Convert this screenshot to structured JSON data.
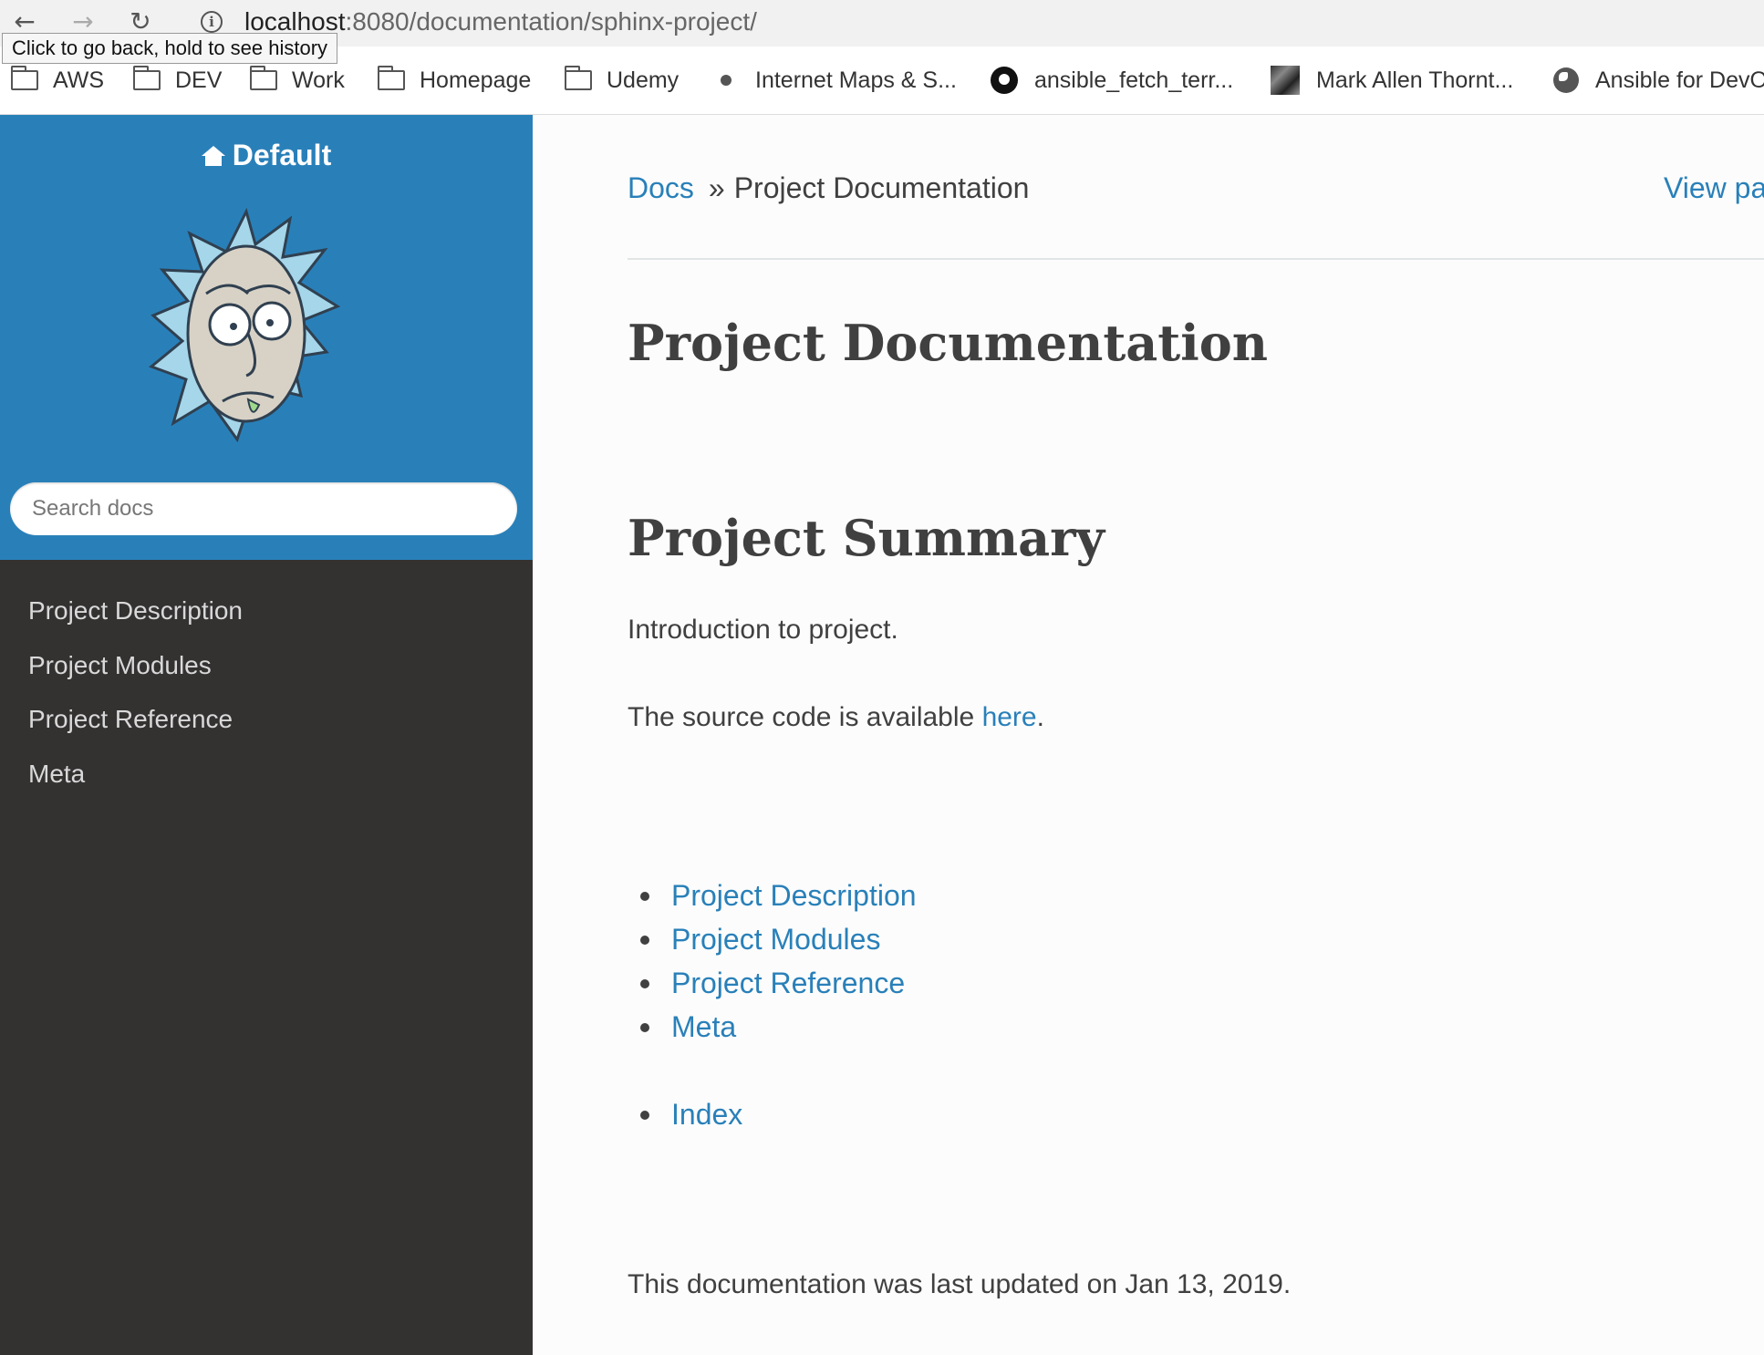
{
  "browser": {
    "url_host": "localhost",
    "url_path": ":8080/documentation/sphinx-project/",
    "tooltip": "Click to go back, hold to see history"
  },
  "bookmarks": [
    {
      "label": "AWS",
      "icon": "folder-icon"
    },
    {
      "label": "DEV",
      "icon": "folder-icon"
    },
    {
      "label": "Work",
      "icon": "folder-icon"
    },
    {
      "label": "Homepage",
      "icon": "folder-icon"
    },
    {
      "label": "Udemy",
      "icon": "folder-icon"
    },
    {
      "label": "Internet Maps & S...",
      "icon": "dot-icon"
    },
    {
      "label": "ansible_fetch_terr...",
      "icon": "github-icon"
    },
    {
      "label": "Mark Allen Thornt...",
      "icon": "thumbnail-icon"
    },
    {
      "label": "Ansible for DevO",
      "icon": "globe-icon"
    }
  ],
  "sidebar": {
    "brand": "Default",
    "search_placeholder": "Search docs",
    "menu": [
      "Project Description",
      "Project Modules",
      "Project Reference",
      "Meta"
    ]
  },
  "content": {
    "breadcrumb_root": "Docs",
    "breadcrumb_sep": "»",
    "breadcrumb_current": "Project Documentation",
    "view_page": "View pa",
    "title": "Project Documentation",
    "section_title": "Project Summary",
    "intro": "Introduction to project.",
    "source_text": "The source code is available ",
    "source_link": "here",
    "source_end": ".",
    "toc": [
      "Project Description",
      "Project Modules",
      "Project Reference",
      "Meta"
    ],
    "toc_index": [
      "Index"
    ],
    "footer": "This documentation was last updated on Jan 13, 2019."
  },
  "colors": {
    "accent": "#2980b9",
    "sidebar_dark": "#343131",
    "text": "#404040"
  }
}
